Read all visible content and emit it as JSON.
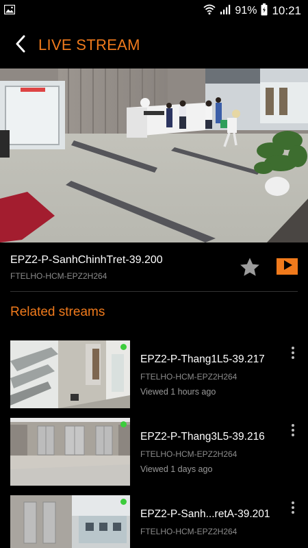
{
  "status_bar": {
    "battery": "91%",
    "time": "10:21"
  },
  "header": {
    "title": "LIVE STREAM"
  },
  "current_stream": {
    "name": "EPZ2-P-SanhChinhTret-39.200",
    "group": "FTELHO-HCM-EPZ2H264"
  },
  "related": {
    "title": "Related streams",
    "items": [
      {
        "name": "EPZ2-P-Thang1L5-39.217",
        "group": "FTELHO-HCM-EPZ2H264",
        "viewed": "Viewed 1 hours ago"
      },
      {
        "name": "EPZ2-P-Thang3L5-39.216",
        "group": "FTELHO-HCM-EPZ2H264",
        "viewed": "Viewed 1 days ago"
      },
      {
        "name": "EPZ2-P-Sanh...retA-39.201",
        "group": "FTELHO-HCM-EPZ2H264",
        "viewed": ""
      }
    ]
  },
  "colors": {
    "accent": "#f07a1c",
    "live_dot": "#3ccc3c",
    "background": "#000000"
  }
}
